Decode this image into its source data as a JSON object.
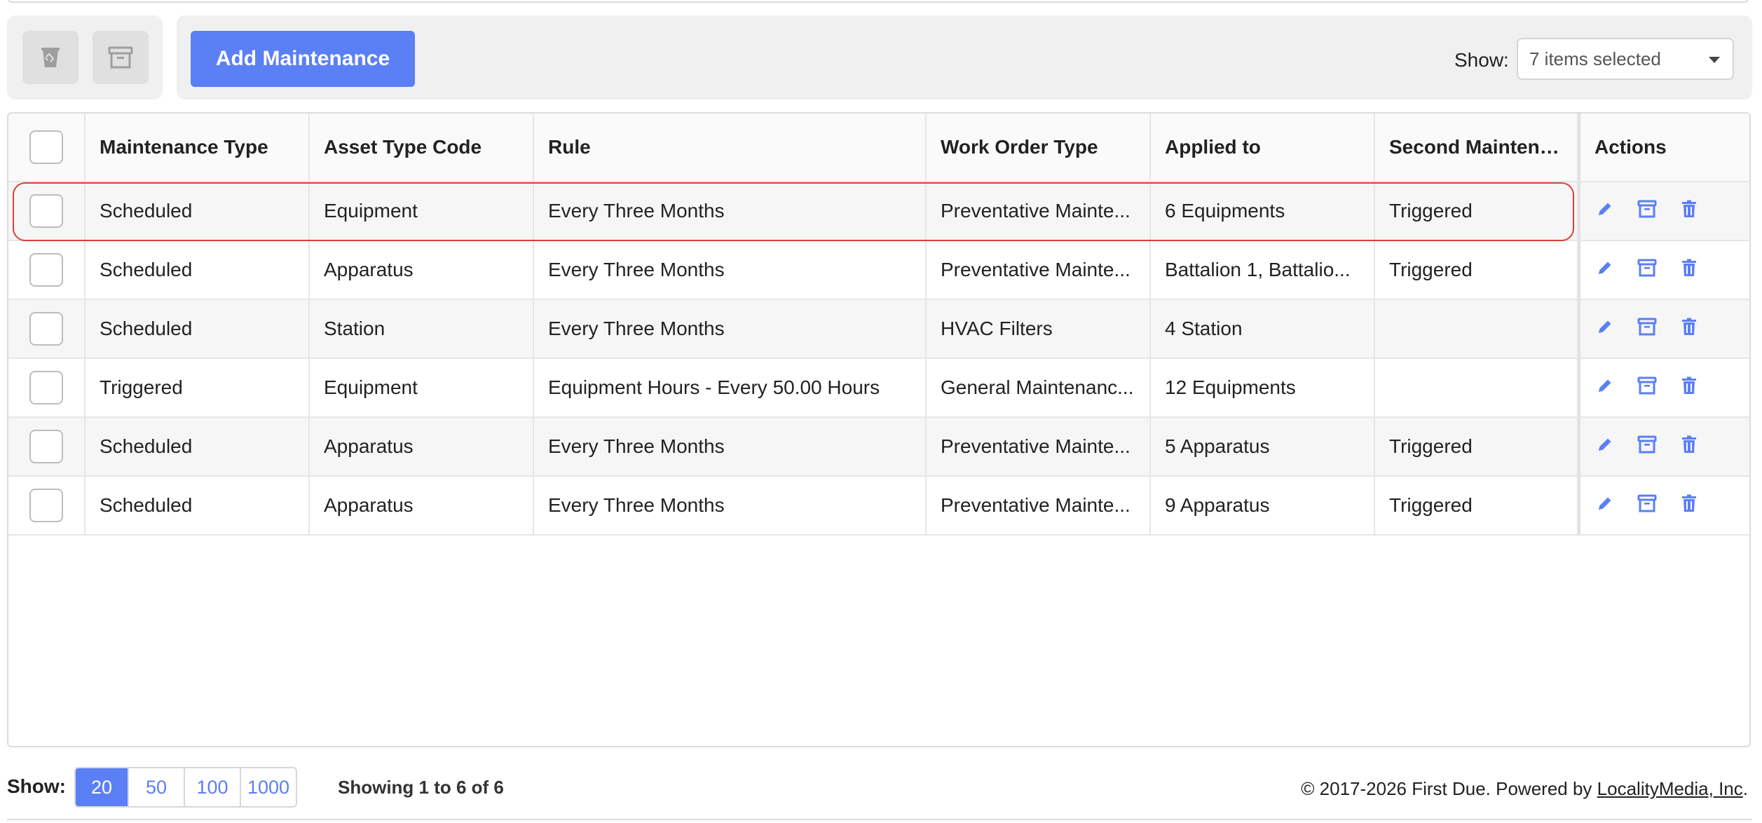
{
  "toolbar": {
    "add_label": "Add Maintenance",
    "show_label": "Show:",
    "show_selected": "7 items selected"
  },
  "table": {
    "headers": [
      "Maintenance Type",
      "Asset Type Code",
      "Rule",
      "Work Order Type",
      "Applied to",
      "Second Maintenanc...",
      "Actions"
    ],
    "rows": [
      [
        "Scheduled",
        "Equipment",
        "Every Three Months",
        "Preventative Mainte...",
        "6 Equipments",
        "Triggered"
      ],
      [
        "Scheduled",
        "Apparatus",
        "Every Three Months",
        "Preventative Mainte...",
        "Battalion 1, Battalio...",
        "Triggered"
      ],
      [
        "Scheduled",
        "Station",
        "Every Three Months",
        "HVAC Filters",
        "4 Station",
        ""
      ],
      [
        "Triggered",
        "Equipment",
        "Equipment Hours - Every 50.00 Hours",
        "General Maintenanc...",
        "12 Equipments",
        ""
      ],
      [
        "Scheduled",
        "Apparatus",
        "Every Three Months",
        "Preventative Mainte...",
        "5 Apparatus",
        "Triggered"
      ],
      [
        "Scheduled",
        "Apparatus",
        "Every Three Months",
        "Preventative Mainte...",
        "9 Apparatus",
        "Triggered"
      ]
    ]
  },
  "footer": {
    "show_label": "Show:",
    "page_sizes": [
      "20",
      "50",
      "100",
      "1000"
    ],
    "active_page_size": "20",
    "showing_text": "Showing 1 to 6 of 6",
    "copyright_prefix": "© 2017-2026 First Due. Powered by ",
    "copyright_link": "LocalityMedia, Inc",
    "copyright_suffix": "."
  },
  "colors": {
    "accent": "#5b7ff5",
    "highlight_border": "#d9412f"
  },
  "icons": {
    "toolbar": [
      "recycle-bin-icon",
      "archive-icon"
    ],
    "row_actions": [
      "pencil-icon",
      "archive-icon",
      "trash-icon"
    ]
  }
}
